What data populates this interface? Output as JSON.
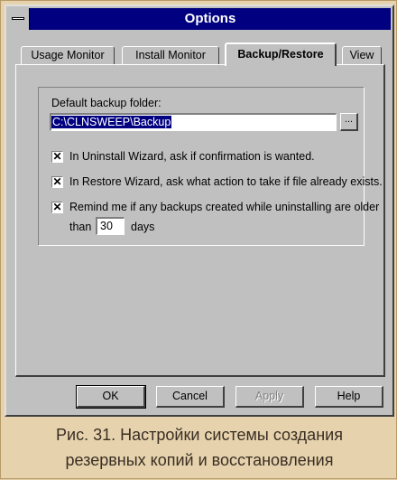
{
  "window": {
    "title": "Options"
  },
  "tabs": [
    {
      "label": "Usage Monitor"
    },
    {
      "label": "Install Monitor"
    },
    {
      "label": "Backup/Restore"
    },
    {
      "label": "View"
    }
  ],
  "backup": {
    "folder_label": "Default backup folder:",
    "folder_value": "C:\\CLNSWEEP\\Backup",
    "browse_label": "..."
  },
  "options": {
    "uninstall": {
      "label": "In Uninstall Wizard, ask if confirmation is wanted.",
      "checked": true
    },
    "restore": {
      "label": "In Restore Wizard, ask what action to take if file already exists.",
      "checked": true
    },
    "remind": {
      "label": "Remind me if any backups created while uninstalling are older",
      "checked": true,
      "than_label": "than",
      "days_value": "30",
      "days_label": "days"
    }
  },
  "buttons": {
    "ok": "OK",
    "cancel": "Cancel",
    "apply": "Apply",
    "help": "Help"
  },
  "caption": {
    "line1": "Рис. 31. Настройки системы создания",
    "line2": "резервных копий и восстановления"
  }
}
